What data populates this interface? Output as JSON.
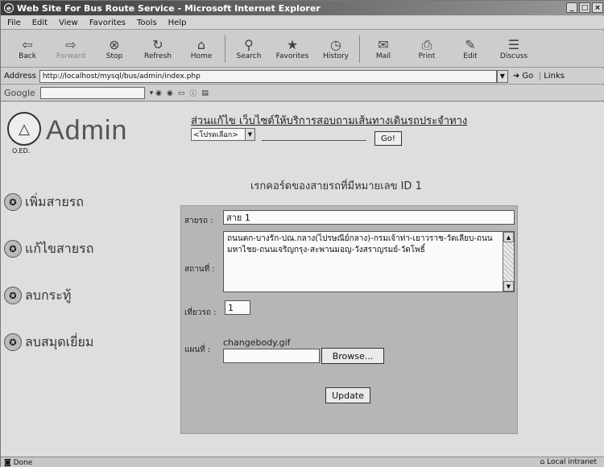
{
  "window": {
    "title": "Web Site For Bus Route Service - Microsoft Internet Explorer"
  },
  "menu": [
    "File",
    "Edit",
    "View",
    "Favorites",
    "Tools",
    "Help"
  ],
  "toolbar": {
    "buttons": [
      {
        "label": "Back",
        "icon": "back-arrow-icon"
      },
      {
        "label": "Forward",
        "icon": "forward-arrow-icon"
      },
      {
        "label": "Stop",
        "icon": "stop-icon"
      },
      {
        "label": "Refresh",
        "icon": "refresh-icon"
      },
      {
        "label": "Home",
        "icon": "home-icon"
      },
      {
        "label": "Search",
        "icon": "search-icon"
      },
      {
        "label": "Favorites",
        "icon": "favorites-icon"
      },
      {
        "label": "History",
        "icon": "history-icon"
      },
      {
        "label": "Mail",
        "icon": "mail-icon"
      },
      {
        "label": "Print",
        "icon": "print-icon"
      },
      {
        "label": "Edit",
        "icon": "edit-icon"
      },
      {
        "label": "Discuss",
        "icon": "discuss-icon"
      }
    ]
  },
  "address": {
    "label": "Address",
    "url": "http://localhost/mysql/bus/admin/index.php",
    "go_label": "Go",
    "links_label": "Links"
  },
  "google": {
    "logo": "Google"
  },
  "header": {
    "title": "Admin",
    "small_label": "O.ED.",
    "subtitle": "ส่วนแก้ไข เว็บไซต์ให้บริการสอบถามเส้นทางเดินรถประจำทาง",
    "select_value": "<โปรดเลือก>",
    "go_button": "Go!"
  },
  "sidebar": {
    "items": [
      {
        "label": "เพิ่มสายรถ"
      },
      {
        "label": "แก้ไขสายรถ"
      },
      {
        "label": "ลบกระทู้"
      },
      {
        "label": "ลบสมุดเยี่ยม"
      }
    ]
  },
  "form": {
    "heading": "เรกคอร์ดของสายรถที่มีหมายเลข ID 1",
    "route_label": "สายรถ :",
    "route_value": "สาย 1",
    "places_label": "สถานที่ :",
    "places_value": "ถนนตก-บางรัก-ปณ.กลาง(ไปรษณีย์กลาง)-กรมเจ้าท่า-เยาวราช-วัดเลียบ-ถนนมหาไชย-ถนนเจริญกรุง-สะพานมอญ-วังสราญรมย์-วัดโพธิ์",
    "trips_label": "เที่ยวรถ :",
    "trips_value": "1",
    "map_label": "แผนที่ :",
    "map_value": "changebody.gif",
    "browse_button": "Browse...",
    "update_button": "Update"
  },
  "status": {
    "text": "Done",
    "zone": "Local intranet"
  }
}
